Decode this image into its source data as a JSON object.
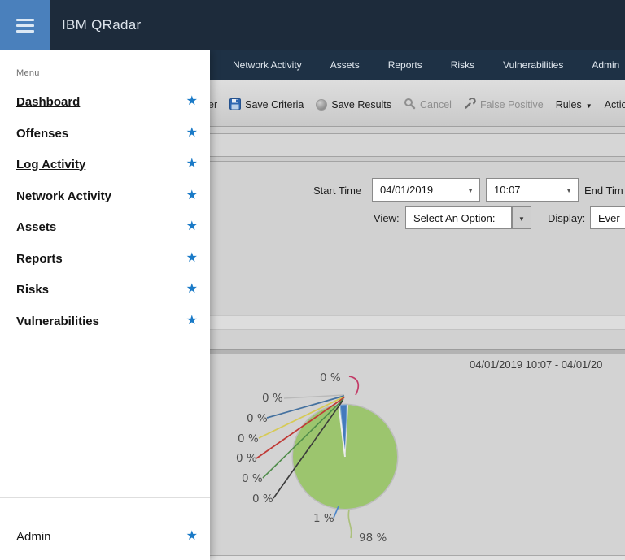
{
  "header": {
    "title": "IBM QRadar"
  },
  "menu": {
    "title": "Menu",
    "items": [
      {
        "label": "Dashboard"
      },
      {
        "label": "Offenses"
      },
      {
        "label": "Log Activity"
      },
      {
        "label": "Network Activity"
      },
      {
        "label": "Assets"
      },
      {
        "label": "Reports"
      },
      {
        "label": "Risks"
      },
      {
        "label": "Vulnerabilities"
      }
    ],
    "admin_label": "Admin",
    "star": "★",
    "star_color": "#1a7ac7"
  },
  "tabs": [
    {
      "label": "Network Activity"
    },
    {
      "label": "Assets"
    },
    {
      "label": "Reports"
    },
    {
      "label": "Risks"
    },
    {
      "label": "Vulnerabilities"
    },
    {
      "label": "Admin"
    }
  ],
  "toolbar": {
    "partial_label": "er",
    "save_criteria": "Save Criteria",
    "save_results": "Save Results",
    "cancel": "Cancel",
    "false_positive": "False Positive",
    "rules": "Rules",
    "actions": "Actions",
    "dropdown_arrow": "▼"
  },
  "filters": {
    "start_time_label": "Start Time",
    "start_date": "04/01/2019",
    "start_clock": "10:07",
    "end_time_label": "End Tim",
    "view_label": "View:",
    "view_value": "Select An Option:",
    "display_label": "Display:",
    "display_value": "Ever",
    "select_arrow": "▼"
  },
  "chart_data": {
    "type": "pie",
    "title": "",
    "date_range": "04/01/2019 10:07 - 04/01/20",
    "legend": "none",
    "labels_format": "percent",
    "slices": [
      {
        "label": "0 %",
        "value": 0,
        "line_color": "#c23a66"
      },
      {
        "label": "0 %",
        "value": 0,
        "line_color": "#b9b9b9"
      },
      {
        "label": "0 %",
        "value": 0,
        "line_color": "#44719f"
      },
      {
        "label": "0 %",
        "value": 0,
        "line_color": "#d6ca55"
      },
      {
        "label": "0 %",
        "value": 0,
        "line_color": "#c03a36"
      },
      {
        "label": "0 %",
        "value": 0,
        "line_color": "#4f8c4a"
      },
      {
        "label": "0 %",
        "value": 0,
        "line_color": "#3b3b3b"
      },
      {
        "label": "1 %",
        "value": 1,
        "line_color": "#4c86c8",
        "color": "#447abc"
      },
      {
        "label": "98 %",
        "value": 98,
        "line_color": "#abc07c",
        "color": "#9cc56e"
      }
    ]
  }
}
